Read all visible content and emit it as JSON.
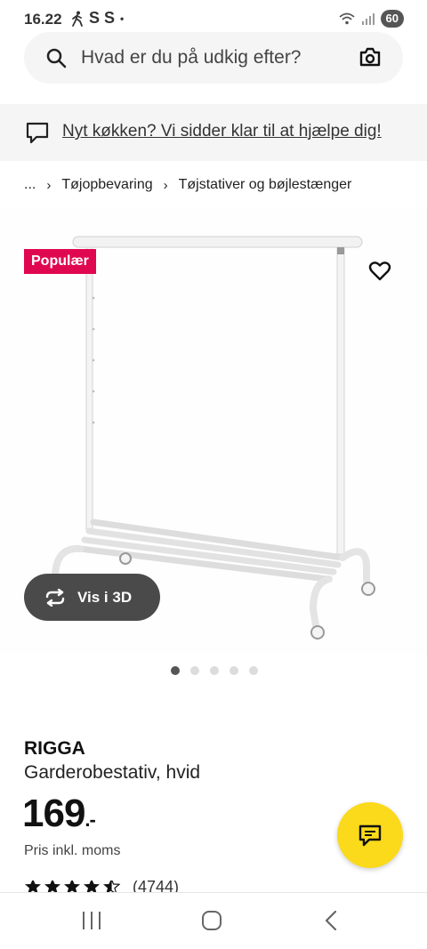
{
  "status_bar": {
    "time": "16.22",
    "letters": "S S",
    "dot": "•",
    "battery": "60"
  },
  "search": {
    "placeholder": "Hvad er du på udkig efter?"
  },
  "promo": {
    "text": "Nyt køkken? Vi sidder klar til at hjælpe dig!"
  },
  "breadcrumb": {
    "ellipsis": "...",
    "items": [
      "Tøjopbevaring",
      "Tøjstativer og bøjlestænger"
    ],
    "separator": "›"
  },
  "product": {
    "badge": "Populær",
    "view_3d_label": "Vis i 3D",
    "name": "RIGGA",
    "description": "Garderobestativ, hvid",
    "price_main": "169",
    "price_suffix": ".-",
    "price_note": "Pris inkl. moms",
    "rating_value": 4.5,
    "rating_count": "(4744)",
    "image_count": 5,
    "active_image": 1
  },
  "colors": {
    "badge_red": "#e00751",
    "chat_yellow": "#fada1a",
    "button_dark": "#4a4a4a"
  },
  "icons": {
    "search": "search-icon",
    "camera": "camera-icon",
    "chat": "chat-bubble-icon",
    "favorite": "heart-icon",
    "rotate": "rotate-3d-icon"
  }
}
